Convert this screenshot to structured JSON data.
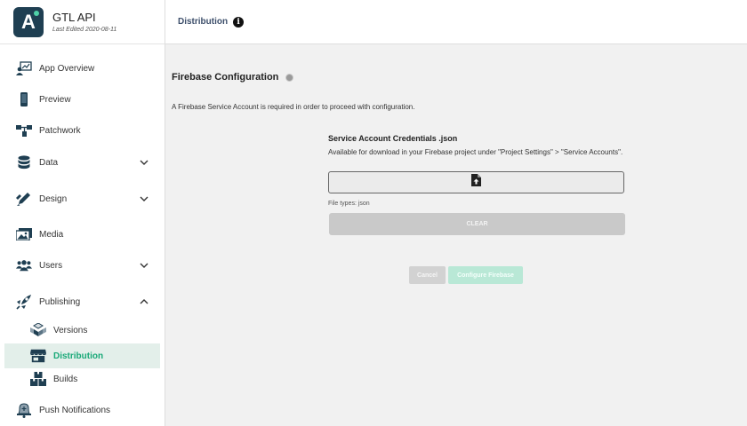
{
  "app": {
    "name": "GTL API",
    "last_edited": "Last Edited 2020-08-11",
    "logo_letter": "A"
  },
  "sidebar": {
    "items": [
      {
        "label": "App Overview",
        "icon": "app-overview-icon"
      },
      {
        "label": "Preview",
        "icon": "phone-icon"
      },
      {
        "label": "Patchwork",
        "icon": "patchwork-icon"
      },
      {
        "label": "Data",
        "icon": "database-icon",
        "expandable": true
      },
      {
        "label": "Design",
        "icon": "pencil-icon",
        "expandable": true
      },
      {
        "label": "Media",
        "icon": "image-icon"
      },
      {
        "label": "Users",
        "icon": "users-icon",
        "expandable": true
      },
      {
        "label": "Publishing",
        "icon": "rocket-icon",
        "expanded": true
      },
      {
        "label": "Versions",
        "icon": "versions-icon",
        "sub": true
      },
      {
        "label": "Distribution",
        "icon": "storefront-icon",
        "sub": true,
        "active": true
      },
      {
        "label": "Builds",
        "icon": "boxes-icon",
        "sub": true
      },
      {
        "label": "Push Notifications",
        "icon": "bell-icon"
      }
    ]
  },
  "topbar": {
    "title": "Distribution",
    "info_glyph": "i"
  },
  "main": {
    "section_title": "Firebase Configuration",
    "intro": "A Firebase Service Account is required in order to proceed with configuration.",
    "field_label": "Service Account Credentials .json",
    "field_help": "Available for download in your Firebase project under \"Project Settings\" > \"Service Accounts\".",
    "file_types": "File types: json",
    "clear_label": "CLEAR",
    "cancel_label": "Cancel",
    "configure_label": "Configure Firebase"
  },
  "colors": {
    "accent": "#19a978",
    "active_bg": "#e3efea",
    "logo_bg": "#1f3f52",
    "configure_disabled": "#b9e8d6"
  }
}
